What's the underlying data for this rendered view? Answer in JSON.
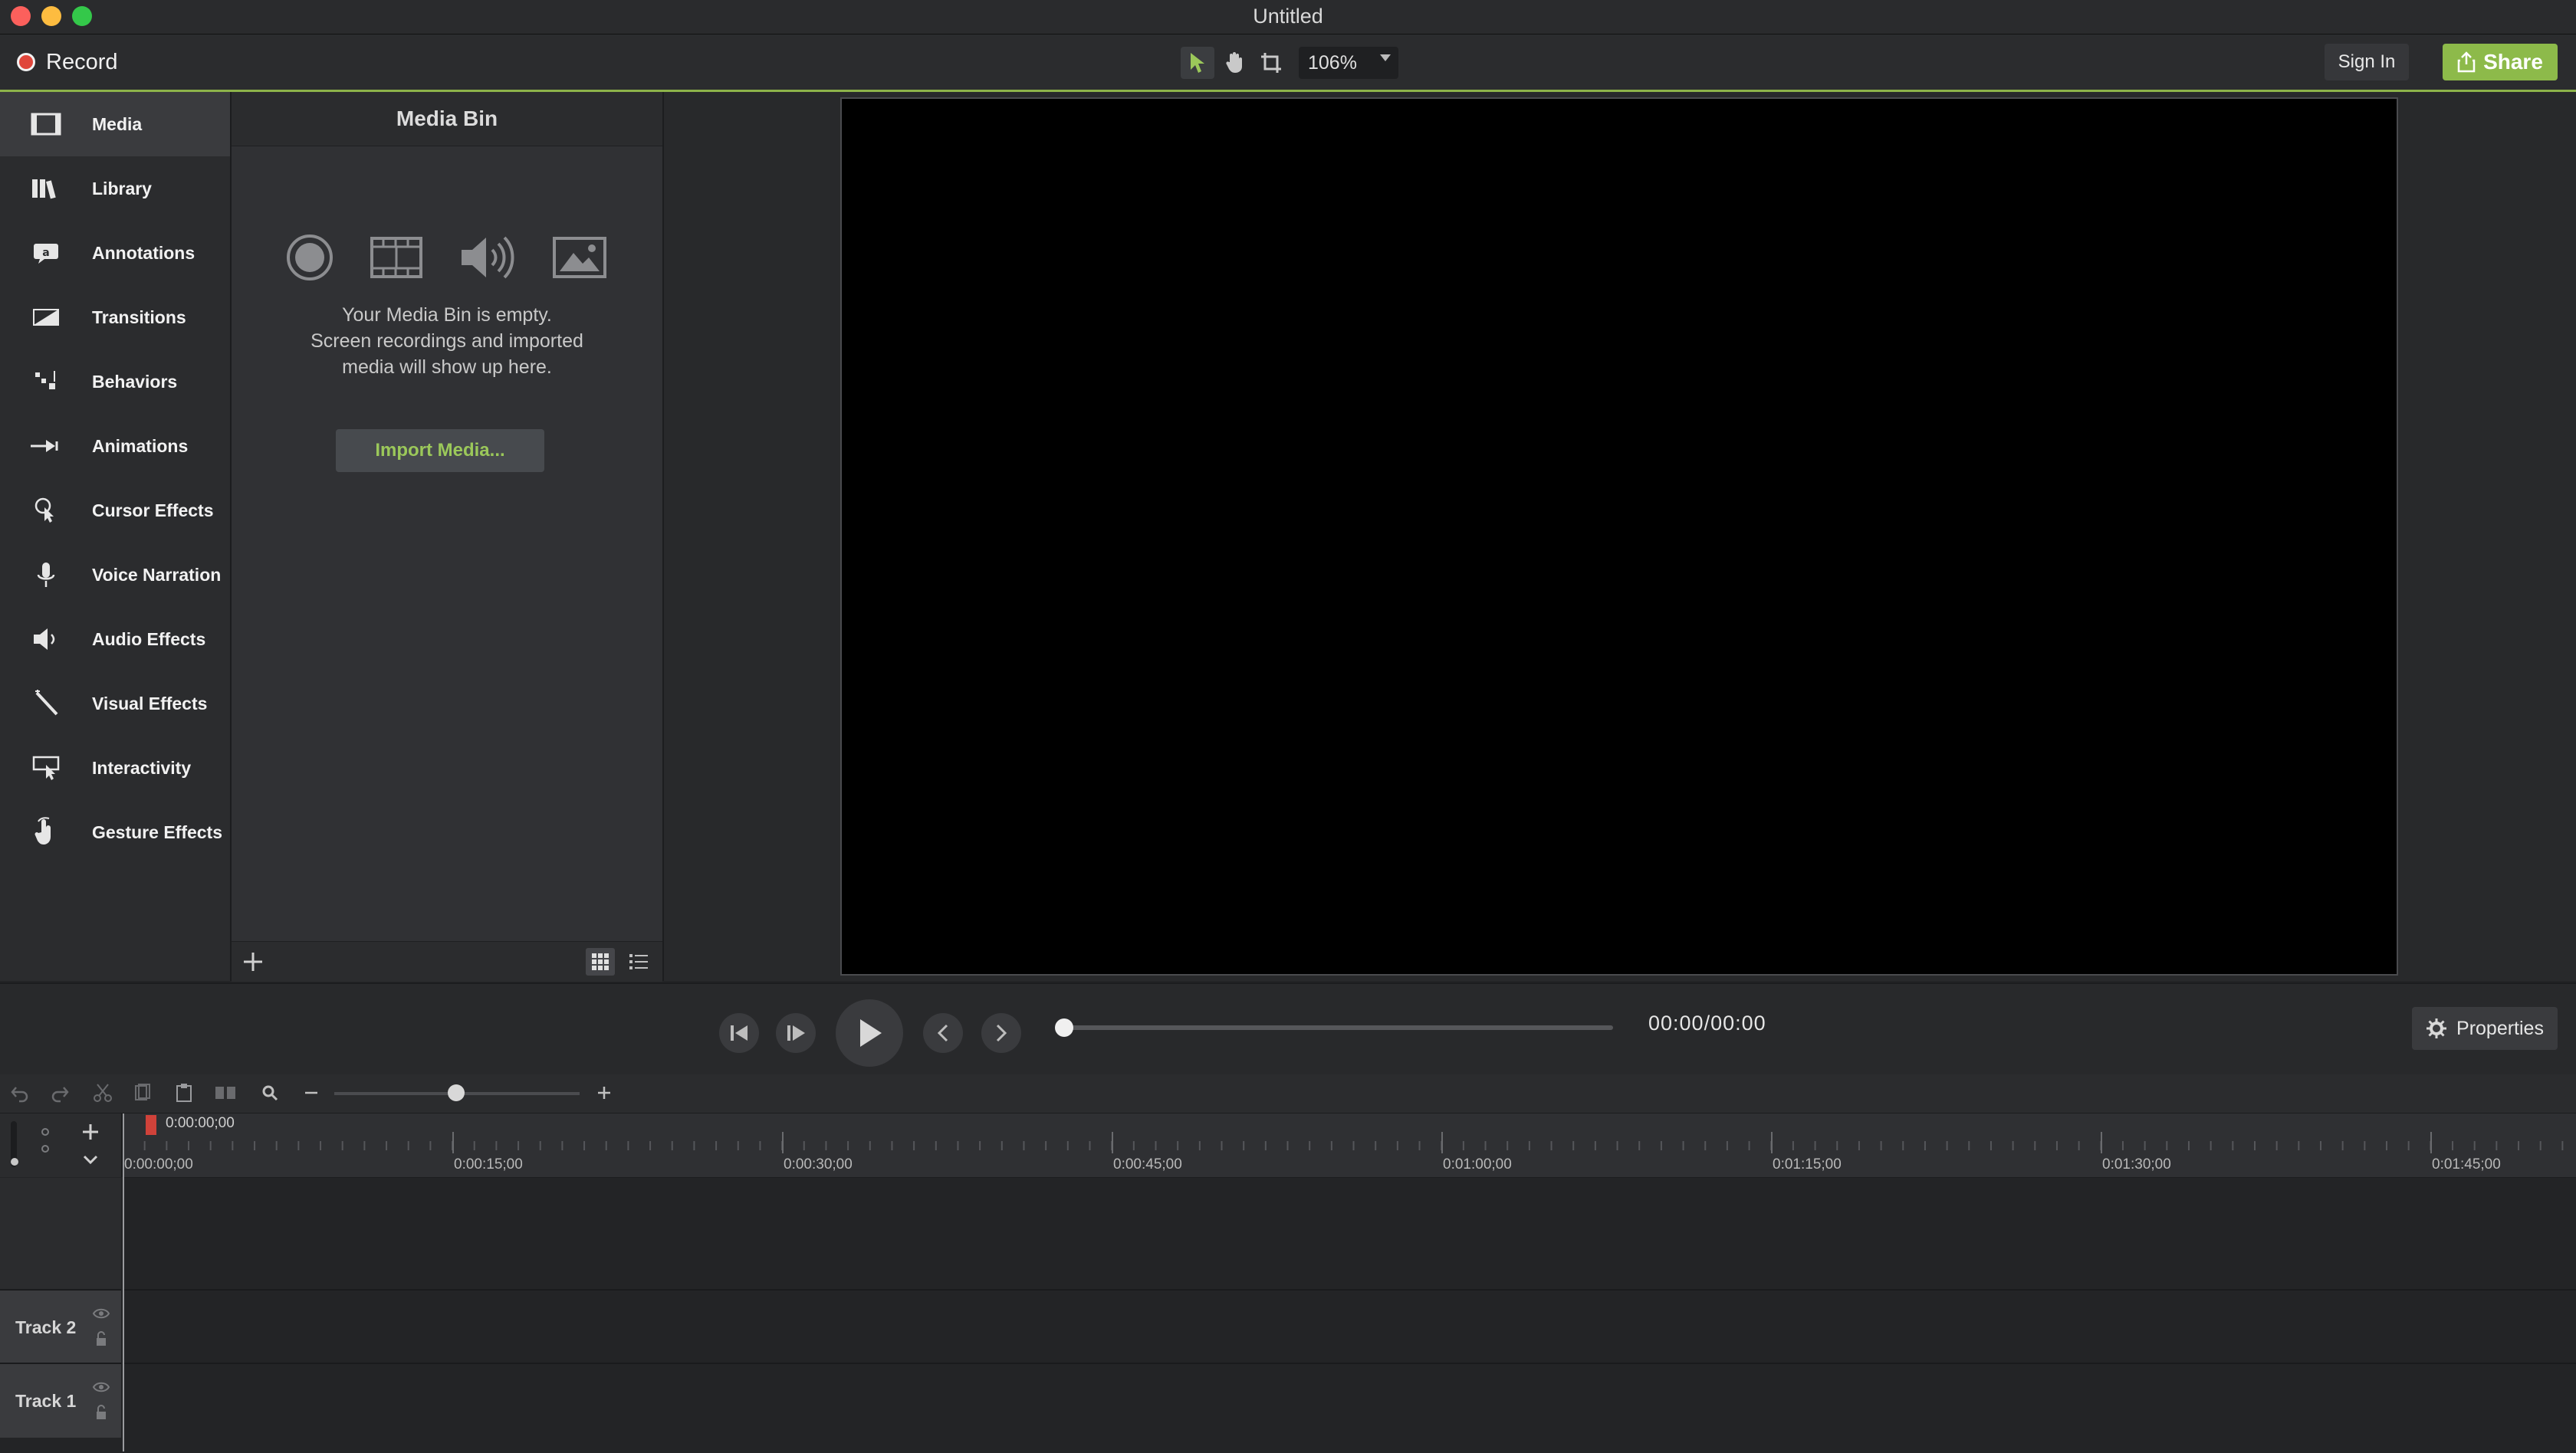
{
  "window": {
    "title": "Untitled"
  },
  "toolbar": {
    "record_label": "Record",
    "zoom_value": "106%",
    "sign_in_label": "Sign In",
    "share_label": "Share"
  },
  "sidebar": {
    "items": [
      {
        "label": "Media",
        "icon": "media-icon"
      },
      {
        "label": "Library",
        "icon": "library-icon"
      },
      {
        "label": "Annotations",
        "icon": "annotations-icon"
      },
      {
        "label": "Transitions",
        "icon": "transitions-icon"
      },
      {
        "label": "Behaviors",
        "icon": "behaviors-icon"
      },
      {
        "label": "Animations",
        "icon": "animations-icon"
      },
      {
        "label": "Cursor Effects",
        "icon": "cursor-effects-icon"
      },
      {
        "label": "Voice Narration",
        "icon": "microphone-icon"
      },
      {
        "label": "Audio Effects",
        "icon": "speaker-icon"
      },
      {
        "label": "Visual Effects",
        "icon": "magic-wand-icon"
      },
      {
        "label": "Interactivity",
        "icon": "interactivity-icon"
      },
      {
        "label": "Gesture Effects",
        "icon": "hand-gesture-icon"
      }
    ]
  },
  "media_bin": {
    "title": "Media Bin",
    "empty_line1": "Your Media Bin is empty.",
    "empty_line2": "Screen recordings and imported",
    "empty_line3": "media will show up here.",
    "import_label": "Import Media..."
  },
  "playback": {
    "timecode": "00:00/00:00",
    "properties_label": "Properties",
    "progress": 0
  },
  "timeline": {
    "playhead_time": "0:00:00;00",
    "ruler_labels": [
      "0:00:00;00",
      "0:00:15;00",
      "0:00:30;00",
      "0:00:45;00",
      "0:01:00;00",
      "0:01:15;00",
      "0:01:30;00",
      "0:01:45;00"
    ],
    "tracks": [
      "Track 2",
      "Track 1"
    ]
  },
  "colors": {
    "accent": "#8dba4a",
    "record": "#e0463b"
  }
}
